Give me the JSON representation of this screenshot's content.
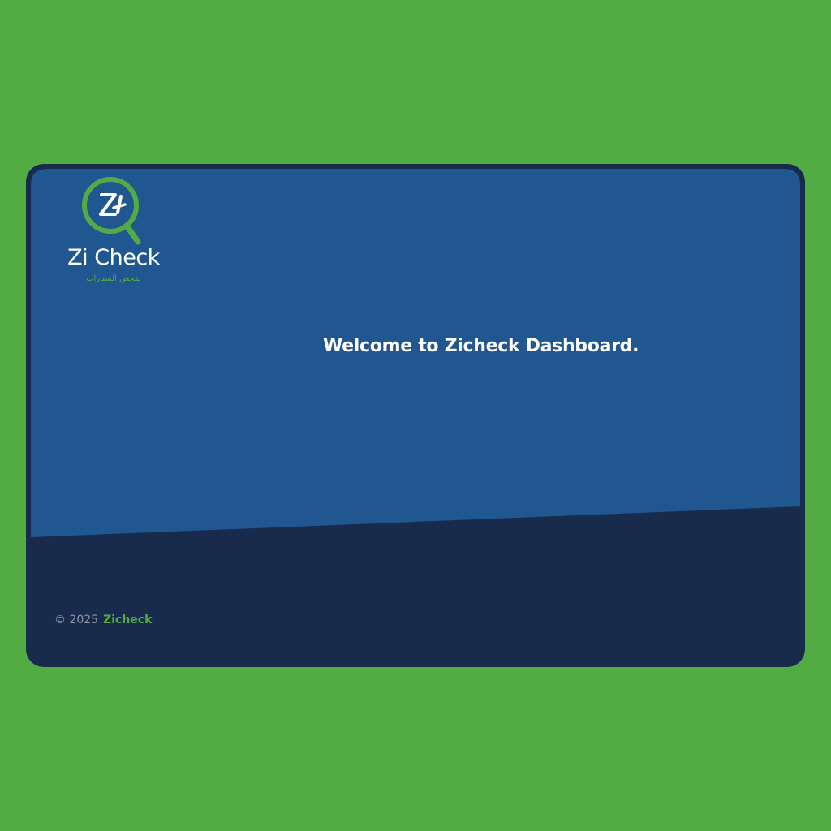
{
  "brand": {
    "name": "Zi Check",
    "tagline_ar": "لفحص السيارات",
    "logo_icon": "zi-magnifier-logo"
  },
  "main": {
    "welcome_text": "Welcome to Zicheck Dashboard."
  },
  "footer": {
    "copyright": "© 2025",
    "brand_link": "Zicheck"
  },
  "colors": {
    "page_background": "#53ac43",
    "card_top": "#215791",
    "card_bottom": "#182b4d",
    "accent_green": "#53ac43",
    "text_white": "#ffffff",
    "muted_text": "#8c96a8"
  }
}
